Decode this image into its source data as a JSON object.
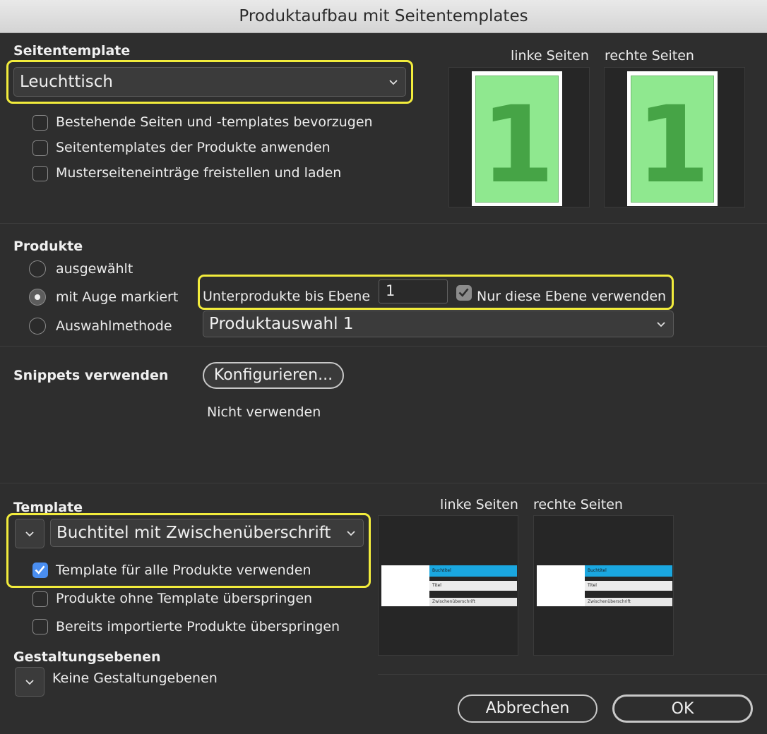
{
  "window": {
    "title": "Produktaufbau mit Seitentemplates"
  },
  "seitentemplate": {
    "label": "Seitentemplate",
    "selected": "Leuchttisch",
    "options": [
      {
        "label": "Bestehende Seiten und -templates bevorzugen",
        "checked": false
      },
      {
        "label": "Seitentemplates der Produkte anwenden",
        "checked": false
      },
      {
        "label": "Musterseiteneinträge freistellen und laden",
        "checked": false
      }
    ],
    "preview": {
      "left_label": "linke Seiten",
      "right_label": "rechte Seiten",
      "left_page_number": "1",
      "right_page_number": "1"
    }
  },
  "produkte": {
    "label": "Produkte",
    "radios": [
      {
        "label": "ausgewählt",
        "selected": false
      },
      {
        "label": "mit Auge markiert",
        "selected": true
      },
      {
        "label": "Auswahlmethode",
        "selected": false
      }
    ],
    "sub_level_label": "Unterprodukte bis Ebene",
    "sub_level_value": "1",
    "only_this_level_label": "Nur diese Ebene verwenden",
    "only_this_level_checked": true,
    "selection_method": "Produktauswahl 1"
  },
  "snippets": {
    "label": "Snippets verwenden",
    "configure_button": "Konfigurieren...",
    "status": "Nicht verwenden"
  },
  "template": {
    "label": "Template",
    "selected": "Buchtitel mit Zwischenüberschrift",
    "use_for_all_label": "Template für alle Produkte verwenden",
    "use_for_all_checked": true,
    "skip_without_template_label": "Produkte ohne Template überspringen",
    "skip_without_template_checked": false,
    "skip_imported_label": "Bereits importierte Produkte überspringen",
    "skip_imported_checked": false,
    "preview": {
      "left_label": "linke Seiten",
      "right_label": "rechte Seiten",
      "row1_text": "Buchtitel",
      "row2_text": "Titel",
      "row3_text": "Zwischenüberschrift"
    }
  },
  "gestaltungsebenen": {
    "label": "Gestaltungsebenen",
    "value": "Keine Gestaltungebenen"
  },
  "buttons": {
    "cancel": "Abbrechen",
    "ok": "OK"
  },
  "colors": {
    "highlight": "#f2ec3c",
    "page_green": "#8fe88f",
    "digit_green": "#46a446",
    "accent_blue": "#4a8ef0",
    "preview_cyan": "#1aa7e0"
  }
}
